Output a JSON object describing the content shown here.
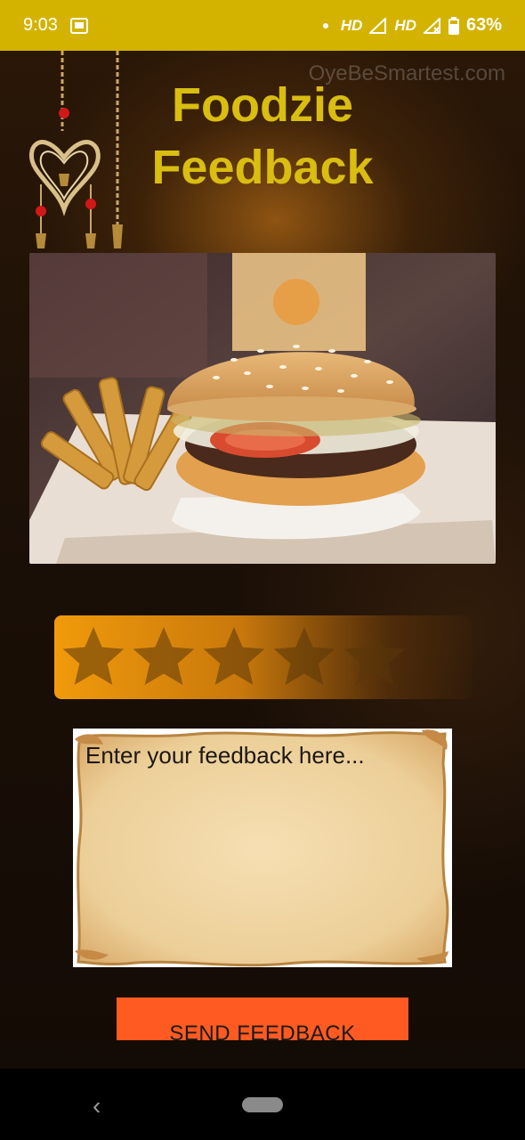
{
  "status_bar": {
    "time": "9:03",
    "signal1": "HD",
    "signal2": "HD",
    "battery": "63%",
    "icons": [
      "screen-record-icon",
      "dot-icon",
      "signal-icon",
      "battery-icon"
    ]
  },
  "watermark": "OyeBeSmartest.com",
  "title": {
    "line1": "Foodzie",
    "line2": "Feedback"
  },
  "rating": {
    "max": 5,
    "value": 0
  },
  "feedback": {
    "placeholder": "Enter your feedback here..."
  },
  "send_button": {
    "label": "SEND FEEDBACK"
  },
  "colors": {
    "status_bar": "#d4b300",
    "title": "#d9bd10",
    "button": "#ff5a21",
    "rating_bar": "#f19a0c"
  }
}
